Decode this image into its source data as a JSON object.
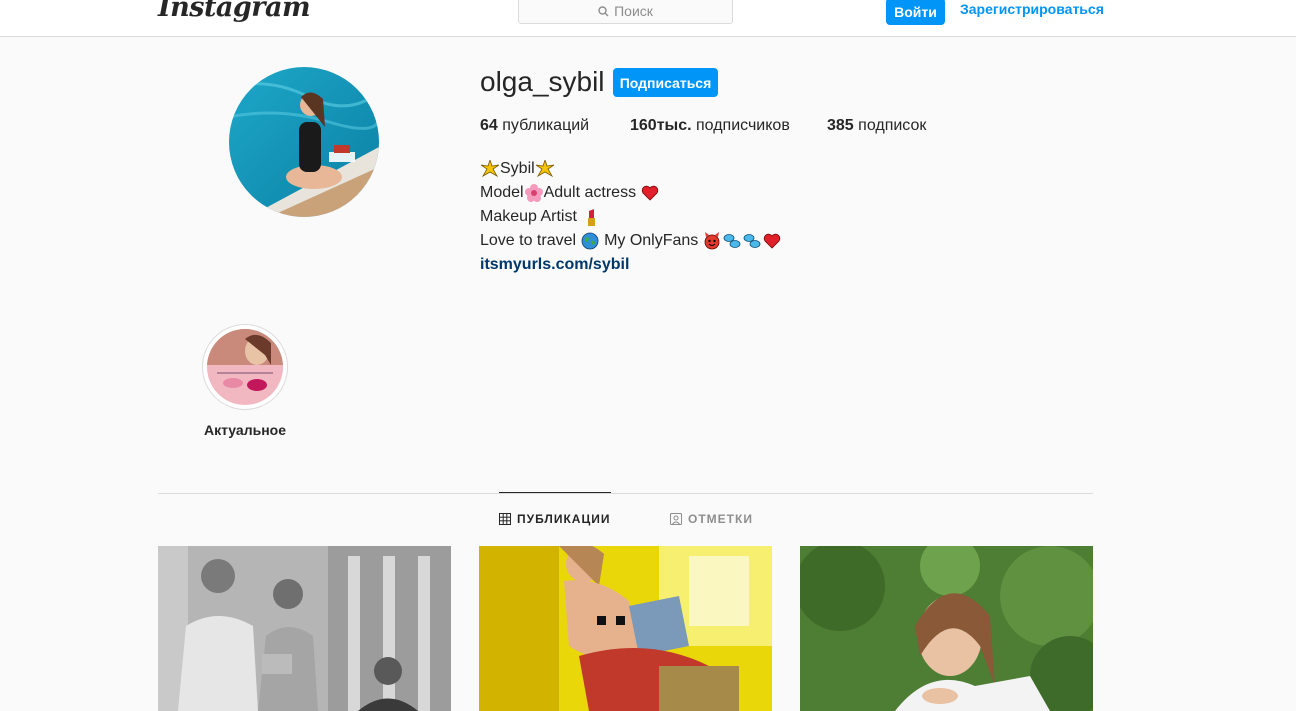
{
  "nav": {
    "logo": "Instagram",
    "search_placeholder": "Поиск",
    "login_label": "Войти",
    "register_label": "Зарегистрироваться"
  },
  "profile": {
    "username": "olga_sybil",
    "follow_label": "Подписаться",
    "stats": [
      {
        "value": "64",
        "label": "публикаций"
      },
      {
        "value": "160тыс.",
        "label": "подписчиков"
      },
      {
        "value": "385",
        "label": "подписок"
      }
    ],
    "bio": {
      "line1": "Sybil",
      "line2a": "Model",
      "line2b": "Adult actress",
      "line3": "Makeup Artist",
      "line4a": "Love to travel",
      "line4b": "My OnlyFans",
      "link": "itsmyurls.com/sybil"
    }
  },
  "highlights": [
    {
      "label": "Актуальное"
    }
  ],
  "tabs": [
    {
      "label": "ПУБЛИКАЦИИ",
      "active": true
    },
    {
      "label": "ОТМЕТКИ",
      "active": false
    }
  ],
  "colors": {
    "accent": "#0095f6",
    "link": "#00376b",
    "background": "#fafafa"
  }
}
